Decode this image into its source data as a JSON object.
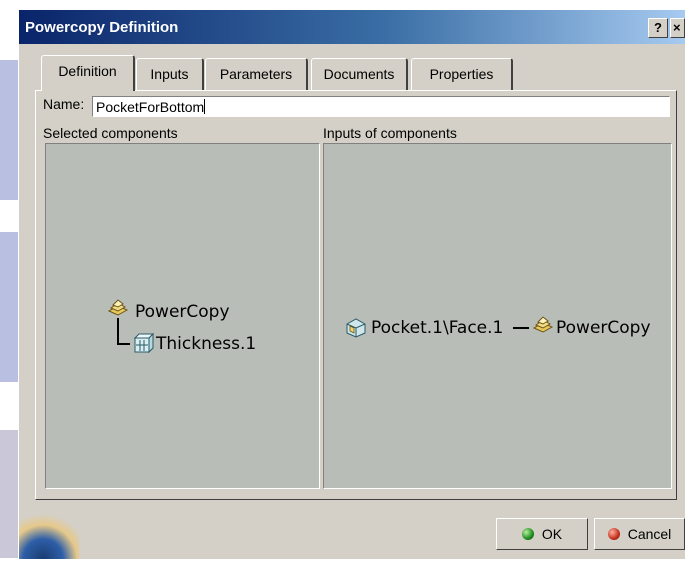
{
  "window": {
    "title": "Powercopy Definition",
    "help_label": "?",
    "close_label": "×"
  },
  "tabs": [
    {
      "label": "Definition",
      "active": true
    },
    {
      "label": "Inputs",
      "active": false
    },
    {
      "label": "Parameters",
      "active": false
    },
    {
      "label": "Documents",
      "active": false
    },
    {
      "label": "Properties",
      "active": false
    }
  ],
  "name_field": {
    "label": "Name:",
    "value": "PocketForBottom"
  },
  "selected_components": {
    "label": "Selected components",
    "tree": [
      {
        "label": "PowerCopy",
        "icon": "powercopy-icon"
      },
      {
        "label": "Thickness.1",
        "icon": "thickness-icon"
      }
    ]
  },
  "inputs_of_components": {
    "label": "Inputs of components",
    "input": {
      "label": "Pocket.1\\Face.1",
      "icon": "face-input-icon"
    },
    "target": {
      "label": "PowerCopy",
      "icon": "powercopy-icon"
    }
  },
  "buttons": {
    "ok_label": "OK",
    "cancel_label": "Cancel"
  },
  "colors": {
    "title_gradient_start": "#0a246a",
    "title_gradient_end": "#a6caf0",
    "dialog_face": "#d4d0c8",
    "view_background": "#b9bdb8"
  }
}
